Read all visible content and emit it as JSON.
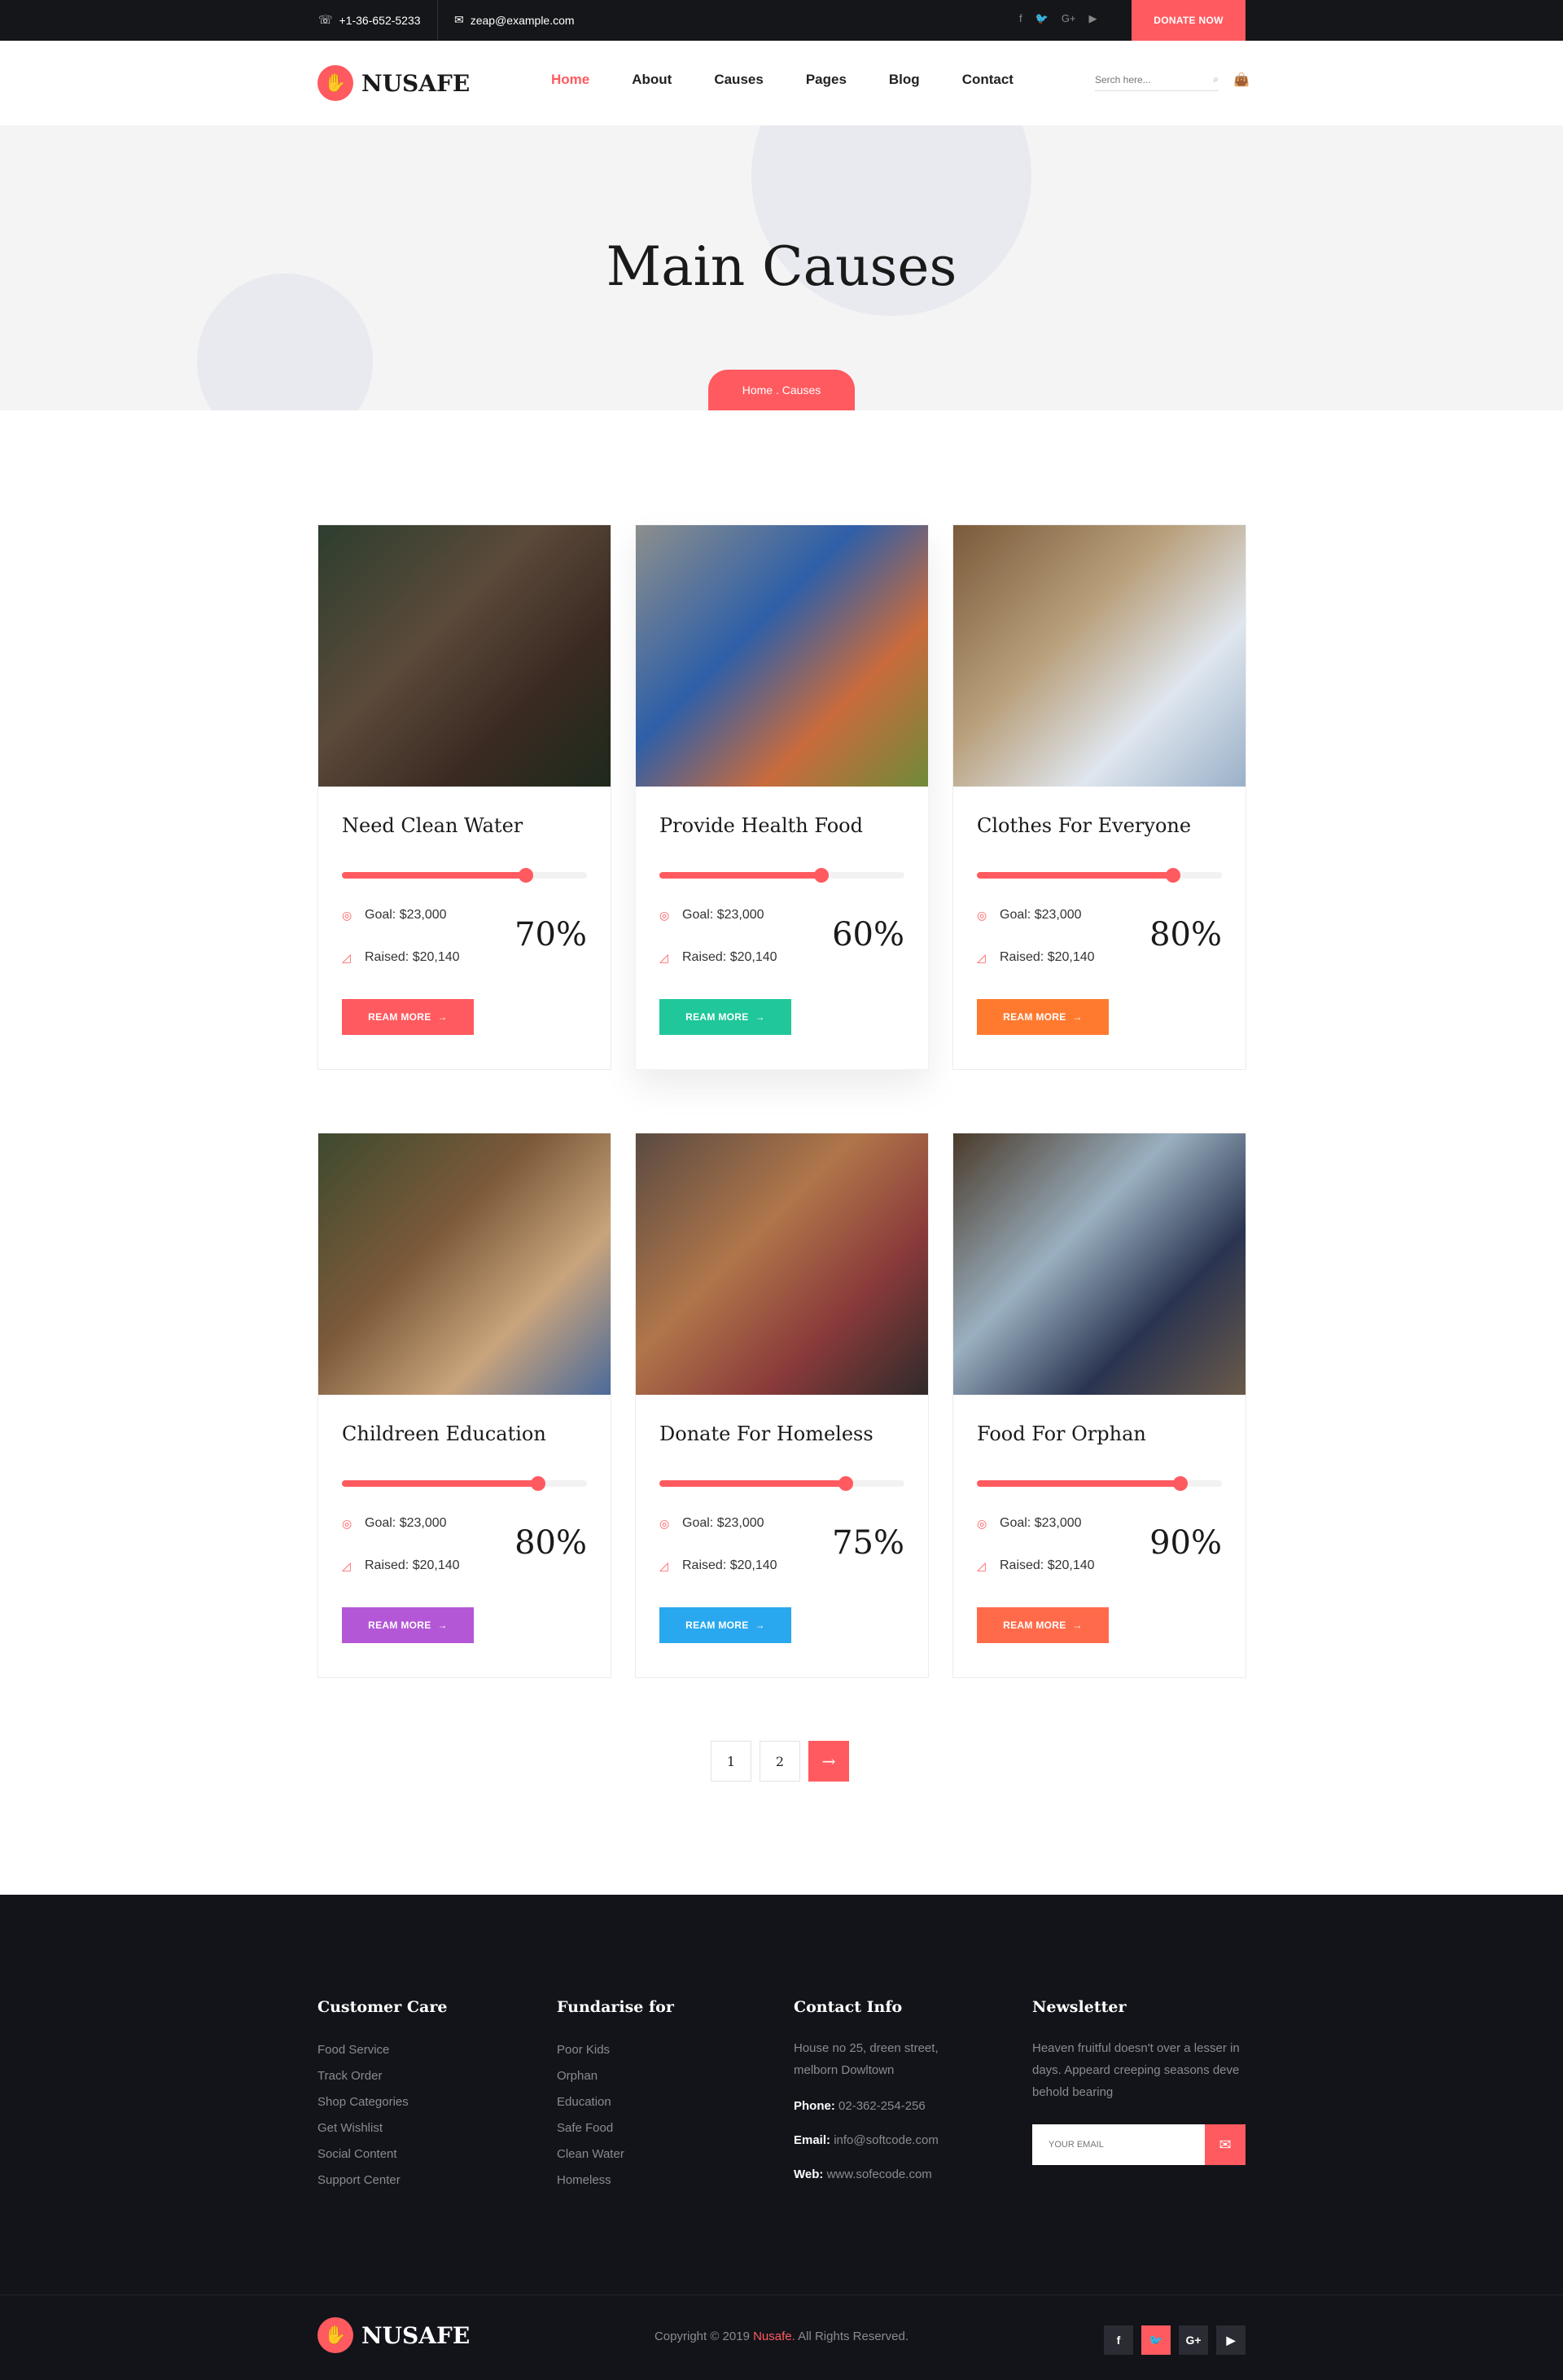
{
  "topbar": {
    "phone": "+1-36-652-5233",
    "email": "zeap@example.com",
    "socials": [
      "f",
      "🐦",
      "G+",
      "▶"
    ],
    "donate_label": "DONATE NOW"
  },
  "header": {
    "logo": "NUSAFE",
    "nav": [
      "Home",
      "About",
      "Causes",
      "Pages",
      "Blog",
      "Contact"
    ],
    "search_placeholder": "Serch here..."
  },
  "hero": {
    "title": "Main Causes",
    "breadcrumb": "Home . Causes"
  },
  "causes": [
    {
      "title": "Need Clean Water",
      "progress": 0.75,
      "goal": "Goal: $23,000",
      "raised": "Raised: $20,140",
      "percent": "70%",
      "button": "REAM MORE",
      "btn_color": "#ff5a5f"
    },
    {
      "title": "Provide Health Food",
      "progress": 0.66,
      "goal": "Goal: $23,000",
      "raised": "Raised: $20,140",
      "percent": "60%",
      "button": "REAM MORE",
      "btn_color": "#1fc79a"
    },
    {
      "title": "Clothes For Everyone",
      "progress": 0.8,
      "goal": "Goal: $23,000",
      "raised": "Raised: $20,140",
      "percent": "80%",
      "button": "REAM MORE",
      "btn_color": "#ff7a2f"
    },
    {
      "title": "Childreen Education",
      "progress": 0.8,
      "goal": "Goal: $23,000",
      "raised": "Raised: $20,140",
      "percent": "80%",
      "button": "REAM MORE",
      "btn_color": "#b457d6"
    },
    {
      "title": "Donate For Homeless",
      "progress": 0.76,
      "goal": "Goal: $23,000",
      "raised": "Raised: $20,140",
      "percent": "75%",
      "button": "REAM MORE",
      "btn_color": "#2aa8ef"
    },
    {
      "title": "Food For Orphan",
      "progress": 0.83,
      "goal": "Goal: $23,000",
      "raised": "Raised: $20,140",
      "percent": "90%",
      "button": "REAM MORE",
      "btn_color": "#ff6b4a"
    }
  ],
  "pagination": {
    "pages": [
      "1",
      "2"
    ],
    "next": "→"
  },
  "footer": {
    "customer_care": {
      "title": "Customer Care",
      "items": [
        "Food Service",
        "Track Order",
        "Shop Categories",
        "Get Wishlist",
        "Social Content",
        "Support Center"
      ]
    },
    "fundraise": {
      "title": "Fundarise for",
      "items": [
        "Poor Kids",
        "Orphan",
        "Education",
        "Safe Food",
        "Clean Water",
        "Homeless"
      ]
    },
    "contact": {
      "title": "Contact Info",
      "address": "House no 25, dreen street, melborn Dowltown",
      "phone_label": "Phone:",
      "phone": "02-362-254-256",
      "email_label": "Email:",
      "email": "info@softcode.com",
      "web_label": "Web:",
      "web": "www.sofecode.com"
    },
    "newsletter": {
      "title": "Newsletter",
      "text": "Heaven fruitful doesn't over a lesser in days. Appeard creeping seasons deve behold bearing",
      "placeholder": "YOUR EMAIL"
    },
    "logo": "NUSAFE",
    "copyright_pre": "Copyright © 2019 ",
    "copyright_brand": "Nusafe.",
    "copyright_post": " All Rights Reserved.",
    "socials": [
      "f",
      "🐦",
      "G+",
      "▶"
    ]
  }
}
